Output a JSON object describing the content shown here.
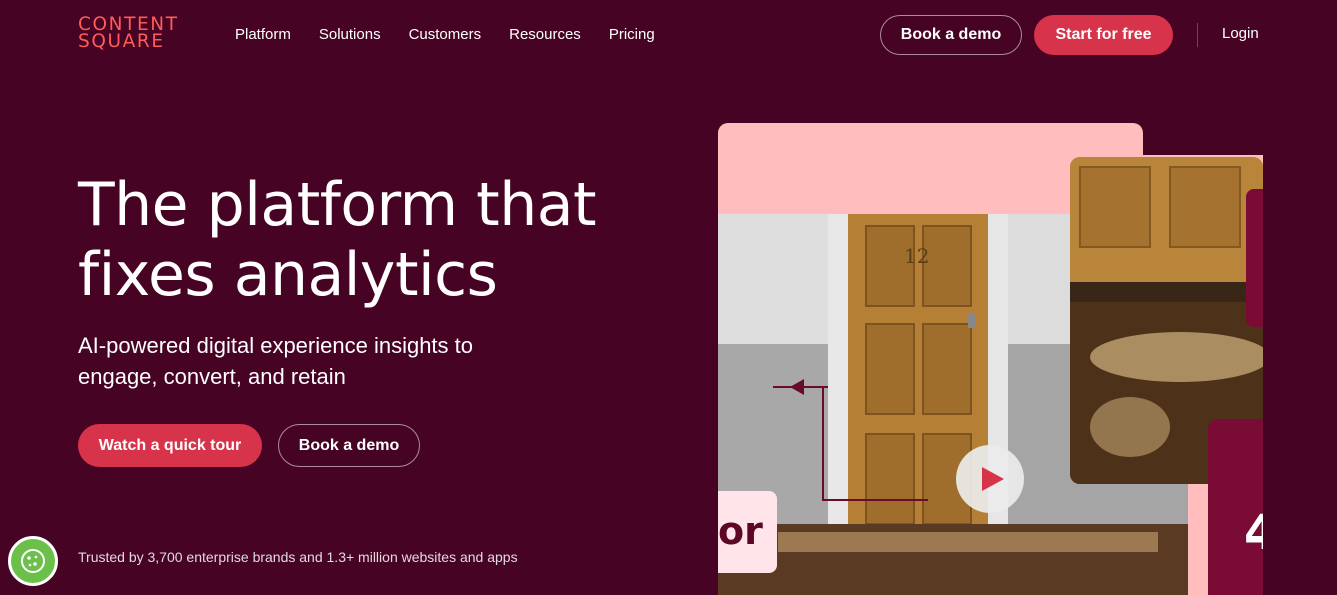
{
  "header": {
    "logo_line1": "CONTENT",
    "logo_line2": "SQUARE",
    "nav": [
      "Platform",
      "Solutions",
      "Customers",
      "Resources",
      "Pricing"
    ],
    "book_demo": "Book a demo",
    "start_free": "Start for free",
    "login": "Login"
  },
  "hero": {
    "title": "The platform that fixes analytics",
    "subtitle": "AI-powered digital experience insights to engage, convert, and retain",
    "cta_primary": "Watch a quick tour",
    "cta_secondary": "Book a demo",
    "trusted": "Trusted by 3,700 enterprise brands and 1.3+ million websites and apps"
  },
  "visual": {
    "door_number": "12",
    "card_text": "or",
    "stat_fragment": "4",
    "play_icon": "play-icon"
  },
  "colors": {
    "background": "#460324",
    "accent": "#d7334b",
    "logo": "#ff5b57",
    "pink": "#ffbdbd",
    "maroon": "#7a0b34"
  },
  "cookie": {
    "icon": "cookie-icon"
  }
}
